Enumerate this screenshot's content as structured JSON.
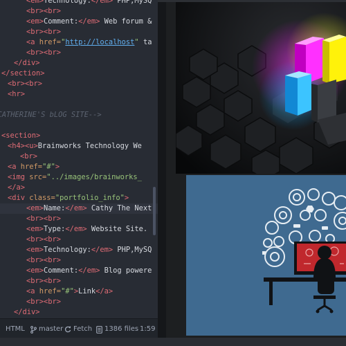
{
  "editor": {
    "lines": [
      {
        "indent": 3,
        "segs": [
          [
            "tag",
            "<em>"
          ],
          [
            "txt",
            "Technology:"
          ],
          [
            "tag",
            "</em>"
          ],
          [
            "txt",
            " PHP,MySQ"
          ]
        ]
      },
      {
        "indent": 3,
        "segs": [
          [
            "tag",
            "<br><br>"
          ]
        ]
      },
      {
        "indent": 3,
        "segs": [
          [
            "tag",
            "<em>"
          ],
          [
            "txt",
            "Comment:"
          ],
          [
            "tag",
            "</em>"
          ],
          [
            "txt",
            " Web forum &"
          ]
        ]
      },
      {
        "indent": 3,
        "segs": [
          [
            "tag",
            "<br><br>"
          ]
        ]
      },
      {
        "indent": 3,
        "segs": [
          [
            "tag",
            "<a "
          ],
          [
            "attr",
            "href="
          ],
          [
            "str",
            "\""
          ],
          [
            "url",
            "http://localhost"
          ],
          [
            "str",
            "\""
          ],
          [
            "txt",
            " ta"
          ]
        ]
      },
      {
        "indent": 3,
        "segs": [
          [
            "tag",
            "<br><br>"
          ]
        ]
      },
      {
        "indent": 2,
        "segs": [
          [
            "tag",
            "</div>"
          ]
        ]
      },
      {
        "indent": 1,
        "segs": [
          [
            "tag",
            "</section>"
          ]
        ]
      },
      {
        "indent": 1.5,
        "segs": [
          [
            "tag",
            "<br><br>"
          ]
        ]
      },
      {
        "indent": 1.5,
        "segs": [
          [
            "tag",
            "<hr>"
          ]
        ]
      },
      {
        "indent": 0,
        "segs": [
          [
            "txt",
            ""
          ]
        ]
      },
      {
        "indent": 0,
        "segs": [
          [
            "cmt",
            "--CATHERINE'S bLOG SITE-->"
          ]
        ]
      },
      {
        "indent": 0,
        "segs": [
          [
            "txt",
            ""
          ]
        ]
      },
      {
        "indent": 1,
        "segs": [
          [
            "tag",
            "<section>"
          ]
        ]
      },
      {
        "indent": 1.5,
        "segs": [
          [
            "tag",
            "<h4><u>"
          ],
          [
            "txt",
            "Brainworks Technology We"
          ]
        ]
      },
      {
        "indent": 2.5,
        "segs": [
          [
            "tag",
            "<br>"
          ]
        ]
      },
      {
        "indent": 1.5,
        "segs": [
          [
            "tag",
            "<a "
          ],
          [
            "attr",
            "href="
          ],
          [
            "str",
            "\"#\""
          ],
          [
            "tag",
            ">"
          ]
        ]
      },
      {
        "indent": 1.5,
        "segs": [
          [
            "tag",
            "<img "
          ],
          [
            "attr",
            "src="
          ],
          [
            "str",
            "\"../images/brainworks_"
          ]
        ]
      },
      {
        "indent": 1.5,
        "segs": [
          [
            "tag",
            "</a>"
          ]
        ]
      },
      {
        "indent": 1.5,
        "segs": [
          [
            "tag",
            "<div "
          ],
          [
            "attr",
            "class="
          ],
          [
            "str",
            "\"portfolio_info\""
          ],
          [
            "tag",
            ">"
          ]
        ]
      },
      {
        "indent": 3,
        "segs": [
          [
            "tag",
            "<em>"
          ],
          [
            "txt",
            "Name:"
          ],
          [
            "tag",
            "</em>"
          ],
          [
            "txt",
            " Cathy The Next"
          ]
        ],
        "hl": true
      },
      {
        "indent": 3,
        "segs": [
          [
            "tag",
            "<br><br>"
          ]
        ]
      },
      {
        "indent": 3,
        "segs": [
          [
            "tag",
            "<em>"
          ],
          [
            "txt",
            "Type:"
          ],
          [
            "tag",
            "</em>"
          ],
          [
            "txt",
            " Website Site."
          ]
        ]
      },
      {
        "indent": 3,
        "segs": [
          [
            "tag",
            "<br><br>"
          ]
        ]
      },
      {
        "indent": 3,
        "segs": [
          [
            "tag",
            "<em>"
          ],
          [
            "txt",
            "Technology:"
          ],
          [
            "tag",
            "</em>"
          ],
          [
            "txt",
            " PHP,MySQ"
          ]
        ]
      },
      {
        "indent": 3,
        "segs": [
          [
            "tag",
            "<br><br>"
          ]
        ]
      },
      {
        "indent": 3,
        "segs": [
          [
            "tag",
            "<em>"
          ],
          [
            "txt",
            "Comment:"
          ],
          [
            "tag",
            "</em>"
          ],
          [
            "txt",
            " Blog powere"
          ]
        ]
      },
      {
        "indent": 3,
        "segs": [
          [
            "tag",
            "<br><br>"
          ]
        ]
      },
      {
        "indent": 3,
        "segs": [
          [
            "tag",
            "<a "
          ],
          [
            "attr",
            "href="
          ],
          [
            "str",
            "\"#\""
          ],
          [
            "tag",
            ">"
          ],
          [
            "txt",
            "Link"
          ],
          [
            "tag",
            "</a>"
          ]
        ]
      },
      {
        "indent": 3,
        "segs": [
          [
            "tag",
            "<br><br>"
          ]
        ]
      },
      {
        "indent": 2,
        "segs": [
          [
            "tag",
            "</div>"
          ]
        ]
      }
    ]
  },
  "statusbar": {
    "grammar": "HTML",
    "branch": "master",
    "fetch": "Fetch",
    "files": "1386 files",
    "cursor": "1:59"
  },
  "colors": {
    "editor_bg": "#282c34",
    "tag": "#e06c75",
    "string": "#98c379",
    "url": "#61afef",
    "attr": "#d19a66",
    "panel_blue": "#3f6a90",
    "screen_red": "#c0282d"
  },
  "icons": {
    "branch": "git-branch-icon",
    "fetch": "sync-icon",
    "files": "file-icon"
  }
}
